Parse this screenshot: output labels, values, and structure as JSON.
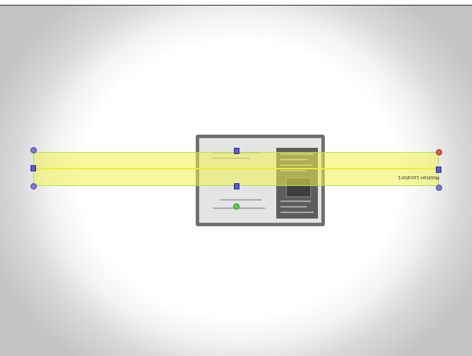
{
  "tool": {
    "label": "Position Locator1"
  },
  "colors": {
    "band_fill": "#f0f050",
    "band_outline": "#a5e34a",
    "center_line": "#eeee2a",
    "handle_blue": "#7a7ad8",
    "handle_red": "#e05a5a",
    "handle_green": "#5ad25a"
  }
}
